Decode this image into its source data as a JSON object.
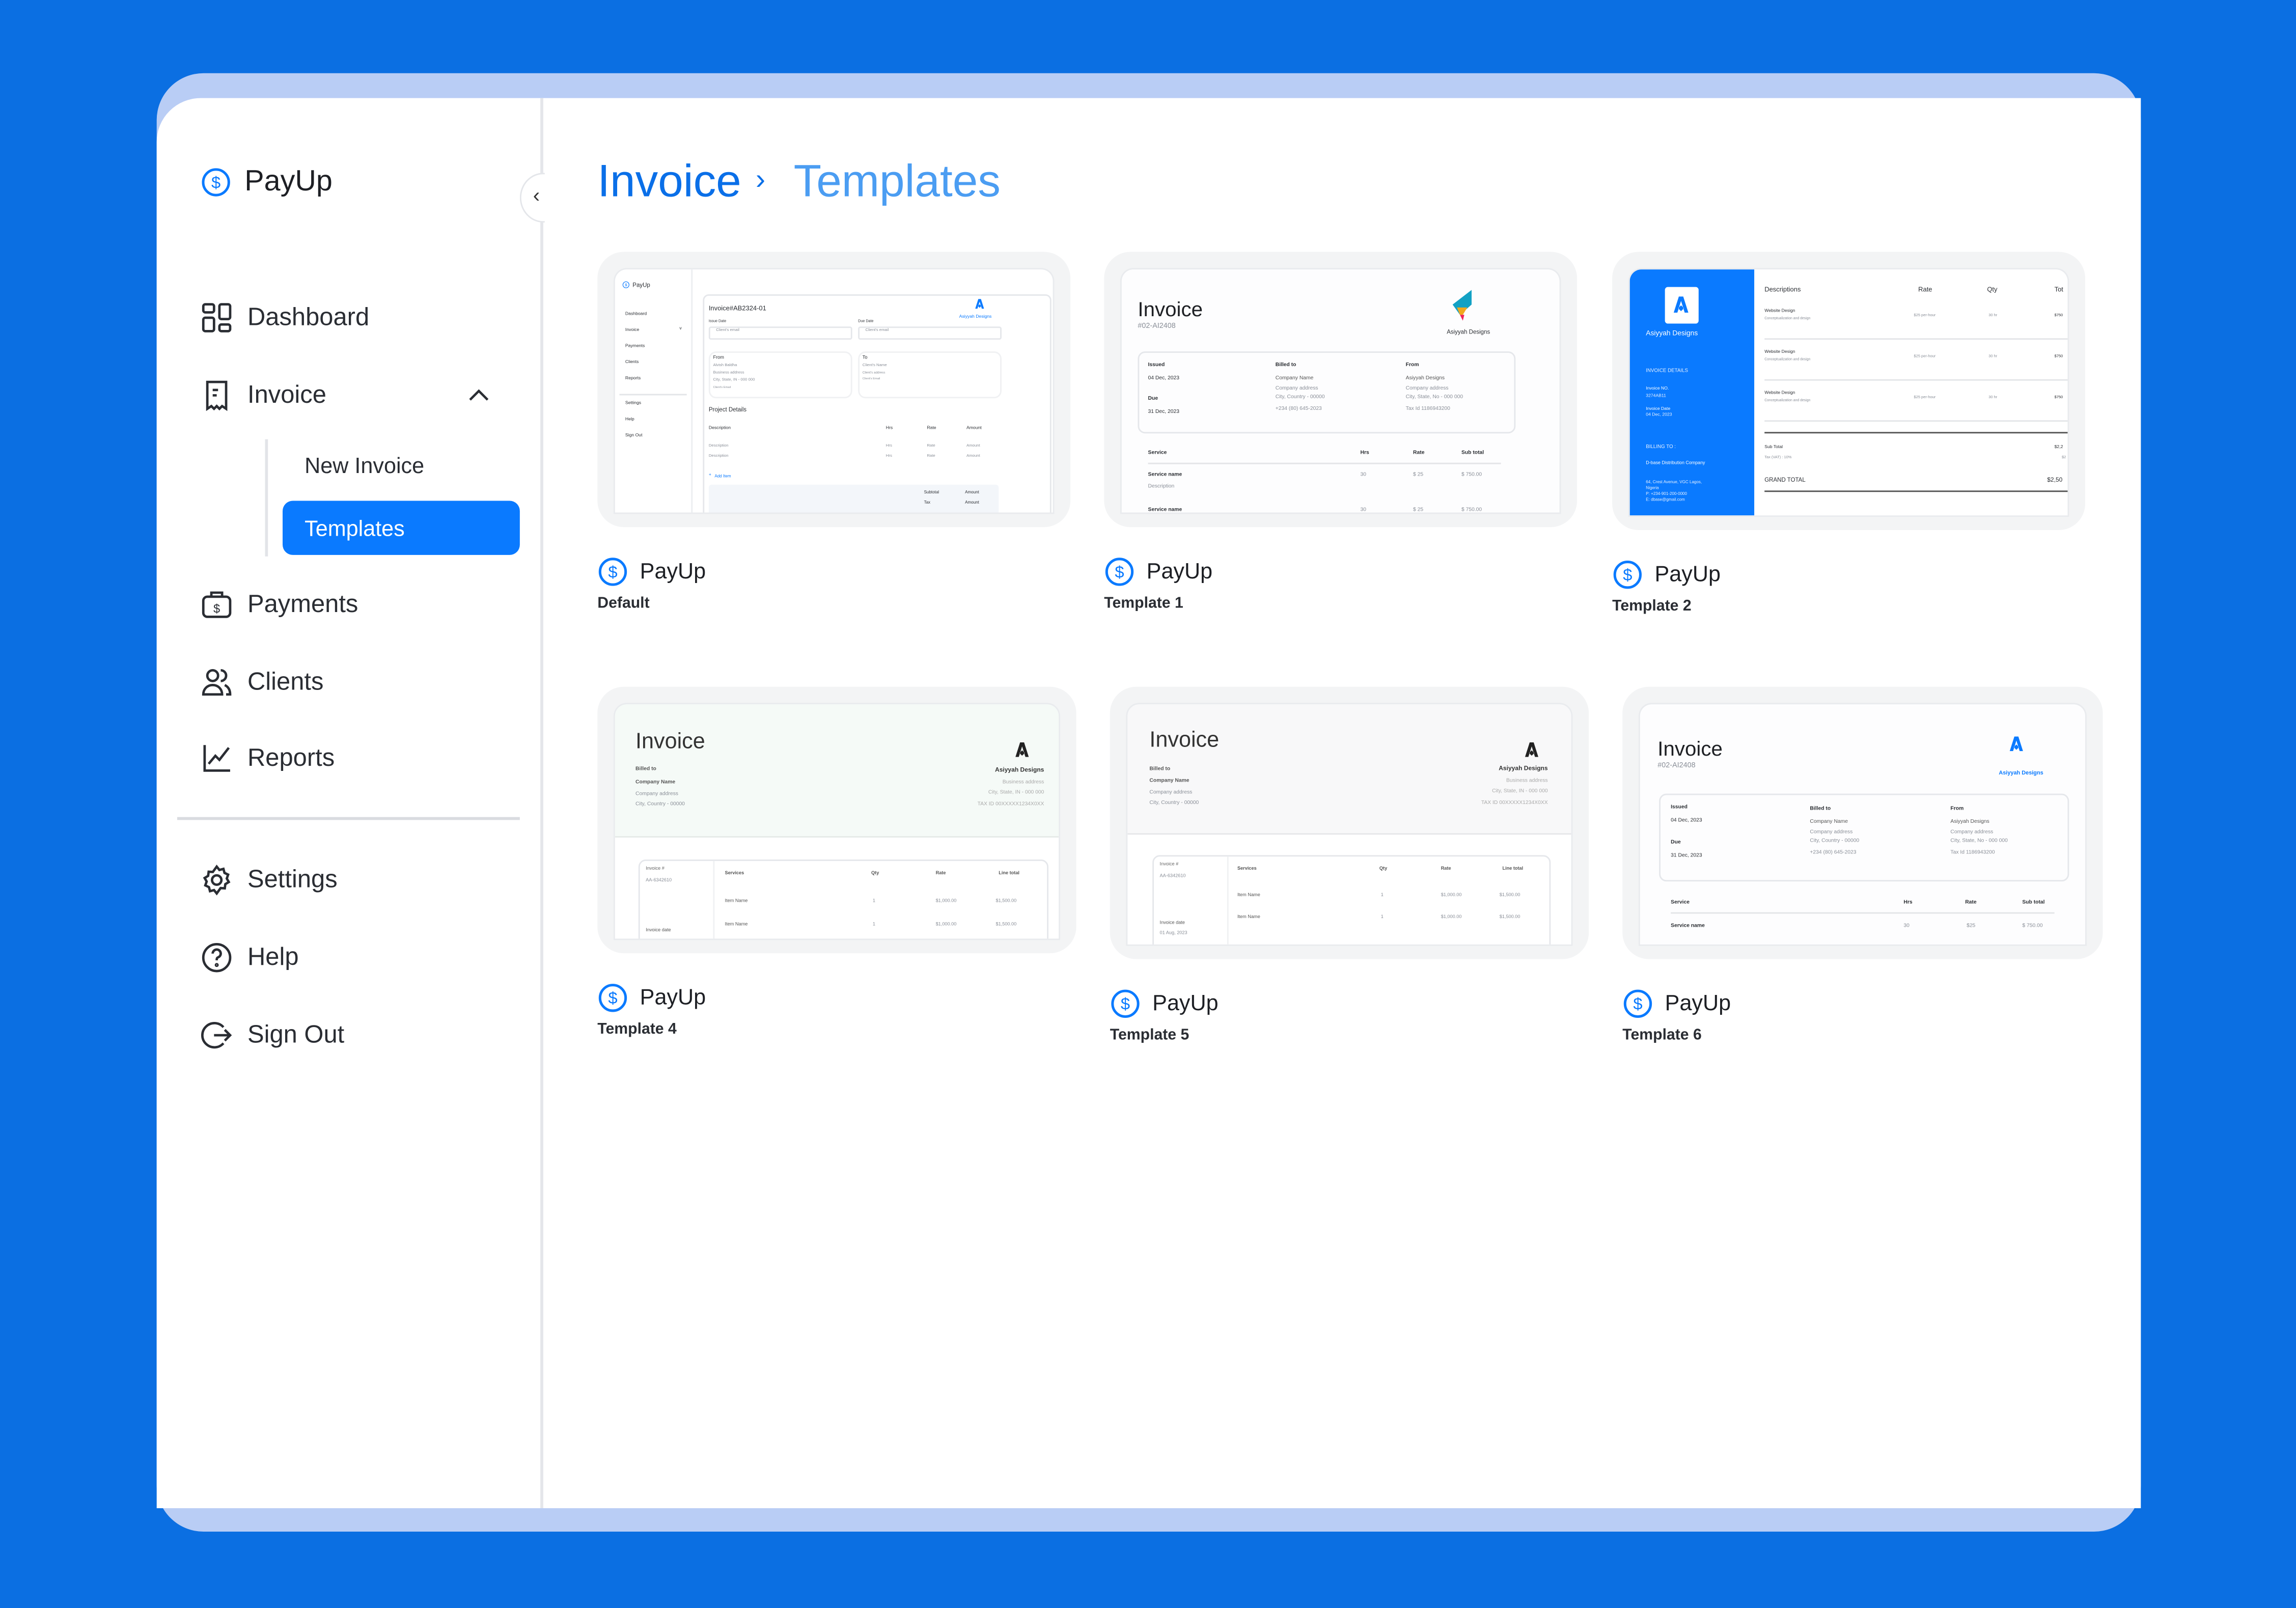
{
  "app": {
    "name": "PayUp"
  },
  "colors": {
    "background": "#0b6fe2",
    "accent": "#0a7aff",
    "frame": "#b9cdf5",
    "breadcrumb_current": "#4b9df2"
  },
  "sidebar": {
    "collapse_icon": "chevron-left-icon",
    "items": [
      {
        "label": "Dashboard",
        "icon": "grid-icon"
      },
      {
        "label": "Invoice",
        "icon": "receipt-icon",
        "expanded": true
      },
      {
        "label": "Payments",
        "icon": "wallet-icon"
      },
      {
        "label": "Clients",
        "icon": "users-icon"
      },
      {
        "label": "Reports",
        "icon": "chart-icon"
      },
      {
        "label": "Settings",
        "icon": "gear-icon"
      },
      {
        "label": "Help",
        "icon": "help-icon"
      },
      {
        "label": "Sign Out",
        "icon": "sign-out-icon"
      }
    ],
    "submenu": [
      {
        "label": "New Invoice"
      },
      {
        "label": "Templates",
        "active": true
      }
    ]
  },
  "breadcrumb": {
    "parent": "Invoice",
    "current": "Templates"
  },
  "templates": [
    {
      "brand": "PayUp",
      "name": "Default",
      "preview": {
        "brand": "PayUp",
        "nav": [
          "Dashboard",
          "Invoice",
          "Payments",
          "Clients",
          "Reports",
          "Settings",
          "Help",
          "Sign Out"
        ],
        "title": "Invoice#AB2324-01",
        "company": "Asiyyah Designs",
        "issue_label": "Issue Date",
        "due_label": "Due Date",
        "email_placeholder": "Client's email",
        "from_label": "From",
        "from_lines": [
          "Alvish Baldha",
          "Business address",
          "City, State, IN - 000 000",
          "Client's Email"
        ],
        "to_label": "To",
        "to_lines": [
          "Client's Name",
          "Client's address",
          "Client's Email"
        ],
        "section": "Project Details",
        "columns": [
          "Description",
          "Hrs",
          "Rate",
          "Amount"
        ],
        "rows": [
          [
            "Description",
            "Hrs",
            "Rate",
            "Amount"
          ],
          [
            "Description",
            "Hrs",
            "Rate",
            "Amount"
          ]
        ],
        "add_item": "Add Item",
        "subtotal": [
          "Subtotal",
          "Amount"
        ],
        "tax": [
          "Tax",
          "Amount"
        ]
      }
    },
    {
      "brand": "PayUp",
      "name": "Template 1",
      "preview": {
        "title": "Invoice",
        "number": "#02-AI2408",
        "company": "Asiyyah Designs",
        "issued_label": "Issued",
        "issued": "04 Dec, 2023",
        "due_label": "Due",
        "due": "31 Dec, 2023",
        "billed_label": "Billed to",
        "billed_lines": [
          "Company Name",
          "Company address",
          "City, Country - 00000",
          "+234 (80) 645-2023"
        ],
        "from_label": "From",
        "from_lines": [
          "Asiyyah Designs",
          "Company address",
          "City, State, No - 000 000",
          "Tax Id 1186943200"
        ],
        "columns": [
          "Service",
          "Hrs",
          "Rate",
          "Sub total"
        ],
        "rows": [
          [
            "Service name",
            "30",
            "$ 25",
            "$ 750.00"
          ],
          [
            "Service name",
            "30",
            "$ 25",
            "$ 750.00"
          ]
        ],
        "row_desc": "Description"
      }
    },
    {
      "brand": "PayUp",
      "name": "Template 2",
      "preview": {
        "company": "Asiyyah Designs",
        "details_heading": "INVOICE DETAILS",
        "invoice_no_label": "Invoice NO.",
        "invoice_no": "3274AB11",
        "invoice_date_label": "Invoice Date",
        "invoice_date": "04 Dec, 2023",
        "billing_heading": "BILLING TO :",
        "client": "D-base Distribution Company",
        "address_lines": [
          "64, Crest Avenue, VGC Lagos,",
          "Nigeria",
          "P: +234-901-200-0000",
          "E: dbase@gmail.com"
        ],
        "columns": [
          "Descriptions",
          "Rate",
          "Qty",
          "Tot"
        ],
        "rows": [
          {
            "title": "Website Design",
            "desc": "Conceptualization and design",
            "rate": "$25 per-hour",
            "qty": "30 hr",
            "total": "$750"
          },
          {
            "title": "Website Design",
            "desc": "Conceptualization and design",
            "rate": "$25 per-hour",
            "qty": "30 hr",
            "total": "$750"
          },
          {
            "title": "Website Design",
            "desc": "Conceptualization and design",
            "rate": "$25 per-hour",
            "qty": "30 hr",
            "total": "$750"
          }
        ],
        "subtotal_label": "Sub Total",
        "subtotal": "$2,2",
        "tax_label": "Tax (VAT) : 10%",
        "tax": "$2",
        "grand_label": "GRAND TOTAL",
        "grand": "$2,50"
      }
    },
    {
      "brand": "PayUp",
      "name": "Template 4",
      "preview": {
        "title": "Invoice",
        "billed_label": "Billed to",
        "billed_lines": [
          "Company Name",
          "Company address",
          "City, Country - 00000"
        ],
        "company": "Asiyyah Designs",
        "company_lines": [
          "Business address",
          "City, State, IN - 000 000",
          "TAX ID 00XXXXX1234X0XX"
        ],
        "invoice_label": "Invoice #",
        "invoice_no": "AA-6342610",
        "date_label": "Invoice date",
        "columns": [
          "Services",
          "Qty",
          "Rate",
          "Line total"
        ],
        "rows": [
          [
            "Item Name",
            "1",
            "$1,000.00",
            "$1,500.00"
          ],
          [
            "Item Name",
            "1",
            "$1,000.00",
            "$1,500.00"
          ]
        ]
      }
    },
    {
      "brand": "PayUp",
      "name": "Template 5",
      "preview": {
        "title": "Invoice",
        "billed_label": "Billed to",
        "billed_lines": [
          "Company Name",
          "Company address",
          "City, Country - 00000"
        ],
        "company": "Asiyyah Designs",
        "company_lines": [
          "Business address",
          "City, State, IN - 000 000",
          "TAX ID 00XXXXX1234X0XX"
        ],
        "invoice_label": "Invoice #",
        "invoice_no": "AA-6342610",
        "date_label": "Invoice date",
        "date": "01 Aug, 2023",
        "columns": [
          "Services",
          "Qty",
          "Rate",
          "Line total"
        ],
        "rows": [
          [
            "Item Name",
            "1",
            "$1,000.00",
            "$1,500.00"
          ],
          [
            "Item Name",
            "1",
            "$1,000.00",
            "$1,500.00"
          ]
        ]
      }
    },
    {
      "brand": "PayUp",
      "name": "Template 6",
      "preview": {
        "title": "Invoice",
        "number": "#02-AI2408",
        "company": "Asiyyah Designs",
        "issued_label": "Issued",
        "issued": "04 Dec, 2023",
        "due_label": "Due",
        "due": "31 Dec, 2023",
        "billed_label": "Billed to",
        "billed_lines": [
          "Company Name",
          "Company address",
          "City, Country - 00000",
          "+234 (80) 645-2023"
        ],
        "from_label": "From",
        "from_lines": [
          "Asiyyah Designs",
          "Company address",
          "City, State, No - 000 000",
          "Tax Id 1186943200"
        ],
        "columns": [
          "Service",
          "Hrs",
          "Rate",
          "Sub total"
        ],
        "rows": [
          [
            "Service name",
            "30",
            "$25",
            "$ 750.00"
          ]
        ]
      }
    }
  ]
}
